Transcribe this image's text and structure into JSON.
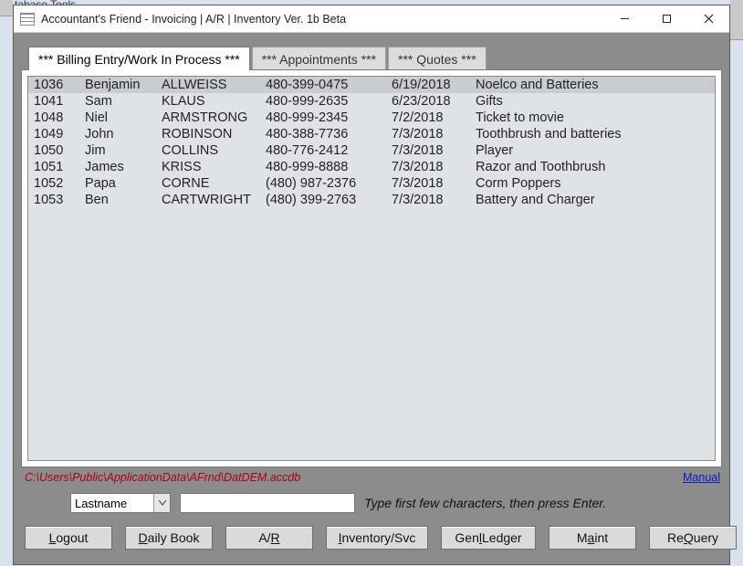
{
  "window": {
    "title": "Accountant's Friend - Invoicing | A/R | Inventory Ver. 1b Beta",
    "truncated_bg_text": "tabase Tools"
  },
  "tabs": [
    {
      "label": "*** Billing Entry/Work In Process ***",
      "active": true
    },
    {
      "label": "*** Appointments ***",
      "active": false
    },
    {
      "label": "*** Quotes ***",
      "active": false
    }
  ],
  "grid_rows": [
    {
      "id": "1036",
      "first": "Benjamin",
      "last": "ALLWEISS",
      "phone": "480-399-0475",
      "date": "6/19/2018",
      "desc": "Noelco and Batteries",
      "selected": true
    },
    {
      "id": "1041",
      "first": "Sam",
      "last": "KLAUS",
      "phone": "480-999-2635",
      "date": "6/23/2018",
      "desc": "Gifts",
      "selected": false
    },
    {
      "id": "1048",
      "first": "Niel",
      "last": "ARMSTRONG",
      "phone": "480-999-2345",
      "date": "7/2/2018",
      "desc": "Ticket to movie",
      "selected": false
    },
    {
      "id": "1049",
      "first": "John",
      "last": "ROBINSON",
      "phone": "480-388-7736",
      "date": "7/3/2018",
      "desc": "Toothbrush and batteries",
      "selected": false
    },
    {
      "id": "1050",
      "first": "Jim",
      "last": "COLLINS",
      "phone": "480-776-2412",
      "date": "7/3/2018",
      "desc": "Player",
      "selected": false
    },
    {
      "id": "1051",
      "first": "James",
      "last": "KRISS",
      "phone": "480-999-8888",
      "date": "7/3/2018",
      "desc": "Razor and Toothbrush",
      "selected": false
    },
    {
      "id": "1052",
      "first": "Papa",
      "last": "CORNE",
      "phone": "(480) 987-2376",
      "date": "7/3/2018",
      "desc": "Corm Poppers",
      "selected": false
    },
    {
      "id": "1053",
      "first": "Ben",
      "last": "CARTWRIGHT",
      "phone": "(480) 399-2763",
      "date": "7/3/2018",
      "desc": "Battery and Charger",
      "selected": false
    }
  ],
  "footer": {
    "path": "C:\\Users\\Public\\ApplicationData\\AFrnd\\DatDEM.accdb",
    "manual": "Manual"
  },
  "search": {
    "field_selected": "Lastname",
    "input_value": "",
    "hint": "Type first few characters, then press Enter."
  },
  "buttons": {
    "logout": {
      "pre": "",
      "ul": "L",
      "post": "ogout"
    },
    "dailybook": {
      "pre": "",
      "ul": "D",
      "post": "aily Book"
    },
    "ar": {
      "pre": "A/",
      "ul": "R",
      "post": ""
    },
    "inventory": {
      "pre": "",
      "ul": "I",
      "post": "nventory/Svc"
    },
    "genledger": {
      "pre": "Gen",
      "ul": "l",
      "post": " Ledger"
    },
    "maint": {
      "pre": "M",
      "ul": "a",
      "post": "int"
    },
    "requery": {
      "pre": "Re",
      "ul": "Q",
      "post": "uery"
    }
  }
}
